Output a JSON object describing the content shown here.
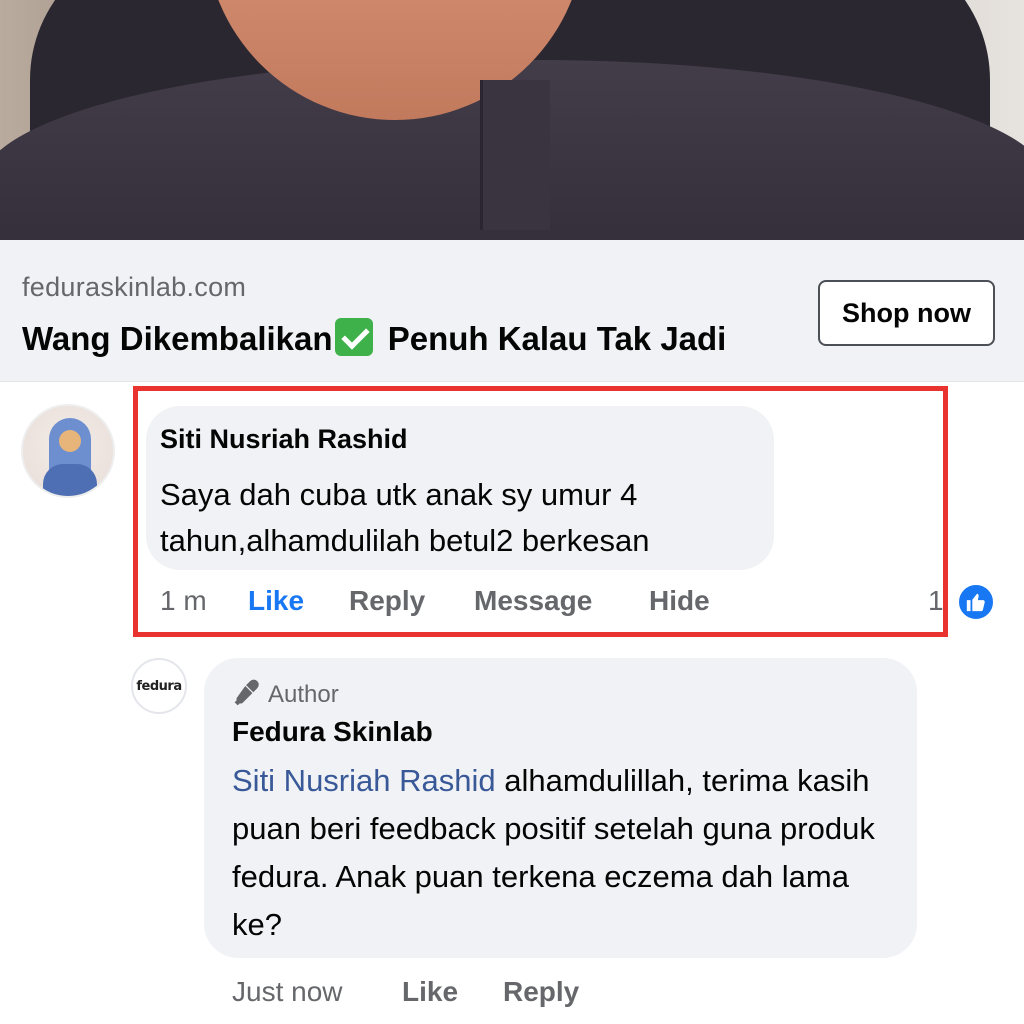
{
  "ad": {
    "domain": "feduraskinlab.com",
    "headline_part1": "Wang Dikembalikan",
    "headline_icon": "check-mark-button-icon",
    "headline_part2": " Penuh Kalau Tak Jadi",
    "cta_label": "Shop now"
  },
  "comments": [
    {
      "author": "Siti Nusriah Rashid",
      "text": "Saya dah cuba utk anak sy umur 4 tahun,alhamdulilah betul2 berkesan",
      "time": "1 m",
      "actions": {
        "like": "Like",
        "reply": "Reply",
        "message": "Message",
        "hide": "Hide"
      },
      "reaction_count": "1",
      "reaction_icon": "like-reaction-icon",
      "highlight_color": "#e8332e"
    }
  ],
  "reply": {
    "avatar_text": "fedura",
    "badge_icon": "microphone-icon",
    "badge": "Author",
    "author": "Fedura Skinlab",
    "mention": "Siti Nusriah Rashid",
    "text": " alhamdulillah, terima kasih puan beri feedback positif setelah guna produk fedura. Anak puan terkena eczema dah lama ke?",
    "time": "Just now",
    "actions": {
      "like": "Like",
      "reply": "Reply"
    }
  },
  "colors": {
    "link_blue": "#1877f2",
    "mention_blue": "#385898",
    "bubble_bg": "#f0f2f5",
    "meta_gray": "#65676b"
  }
}
